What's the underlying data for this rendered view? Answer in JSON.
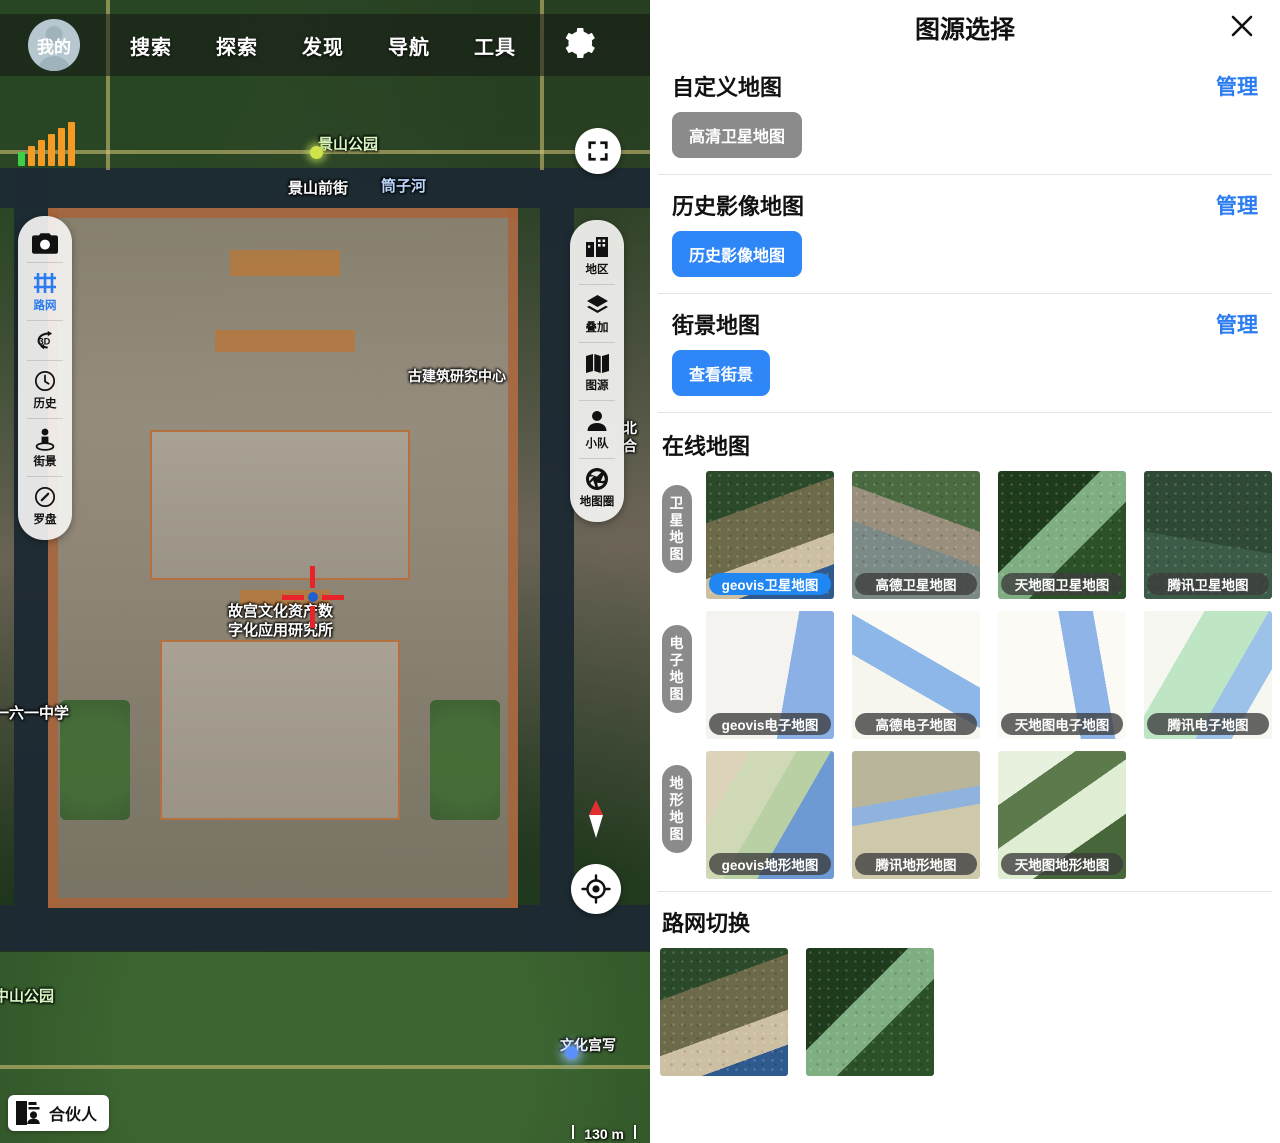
{
  "top_nav": {
    "avatar_label": "我的",
    "items": [
      {
        "label": "搜索",
        "name": "nav-search"
      },
      {
        "label": "探索",
        "name": "nav-explore"
      },
      {
        "label": "发现",
        "name": "nav-discover"
      },
      {
        "label": "导航",
        "name": "nav-navigation"
      },
      {
        "label": "工具",
        "name": "nav-tools"
      }
    ],
    "settings_icon": "gear-icon"
  },
  "map": {
    "scale_label": "130 m",
    "partner_label": "合伙人",
    "labels": [
      {
        "text": "景山公园",
        "color": "green"
      },
      {
        "text": "景山前街",
        "color": "white"
      },
      {
        "text": "筒子河",
        "color": "blue"
      },
      {
        "text": "古建筑研究中心",
        "color": "white"
      },
      {
        "text": "故宫文化资产数\n字化应用研究所",
        "color": "white"
      },
      {
        "text": "一六一中学",
        "color": "white"
      },
      {
        "text": "中山公园",
        "color": "green"
      },
      {
        "text": "文化宫写",
        "color": "white"
      },
      {
        "text": "北\n合",
        "color": "white"
      }
    ],
    "tools_left": [
      {
        "label": "",
        "icon": "camera-icon",
        "name": "map-tool-camera",
        "active": false
      },
      {
        "label": "路网",
        "icon": "road-network-icon",
        "name": "map-tool-road-network",
        "active": true
      },
      {
        "label": "",
        "icon": "3d-rotate-icon",
        "name": "map-tool-3d",
        "active": false
      },
      {
        "label": "历史",
        "icon": "clock-icon",
        "name": "map-tool-history",
        "active": false
      },
      {
        "label": "街景",
        "icon": "street-view-icon",
        "name": "map-tool-streetview",
        "active": false
      },
      {
        "label": "罗盘",
        "icon": "compass-icon",
        "name": "map-tool-compass",
        "active": false
      }
    ],
    "tools_right": [
      {
        "label": "地区",
        "icon": "buildings-icon",
        "name": "map-tool-region"
      },
      {
        "label": "叠加",
        "icon": "layers-icon",
        "name": "map-tool-overlay"
      },
      {
        "label": "图源",
        "icon": "map-book-icon",
        "name": "map-tool-map-source"
      },
      {
        "label": "小队",
        "icon": "team-icon",
        "name": "map-tool-team"
      },
      {
        "label": "地图圈",
        "icon": "aperture-icon",
        "name": "map-tool-map-circle"
      }
    ],
    "fullscreen_icon": "fullscreen-icon",
    "locate_icon": "locate-target-icon",
    "compass_icon": "compass-needle-icon",
    "signal_icon": "signal-bars-icon"
  },
  "panel": {
    "title": "图源选择",
    "close_icon": "close-icon",
    "sections": [
      {
        "title": "自定义地图",
        "manage": "管理",
        "chips": [
          {
            "label": "高清卫星地图",
            "style": "gray"
          }
        ]
      },
      {
        "title": "历史影像地图",
        "manage": "管理",
        "chips": [
          {
            "label": "历史影像地图",
            "style": "blue"
          }
        ]
      },
      {
        "title": "街景地图",
        "manage": "管理",
        "chips": [
          {
            "label": "查看街景",
            "style": "blue"
          }
        ]
      }
    ],
    "online": {
      "title": "在线地图",
      "rows": [
        {
          "tag": "卫星地图",
          "thumbs": [
            {
              "caption": "geovis卫星地图",
              "selected": true,
              "img": "img-sat-1"
            },
            {
              "caption": "高德卫星地图",
              "selected": false,
              "img": "img-sat-2"
            },
            {
              "caption": "天地图卫星地图",
              "selected": false,
              "img": "img-sat-3"
            },
            {
              "caption": "腾讯卫星地图",
              "selected": false,
              "img": "img-sat-4"
            }
          ]
        },
        {
          "tag": "电子地图",
          "thumbs": [
            {
              "caption": "geovis电子地图",
              "selected": false,
              "img": "img-ele-1"
            },
            {
              "caption": "高德电子地图",
              "selected": false,
              "img": "img-ele-2"
            },
            {
              "caption": "天地图电子地图",
              "selected": false,
              "img": "img-ele-3"
            },
            {
              "caption": "腾讯电子地图",
              "selected": false,
              "img": "img-ele-4"
            }
          ]
        },
        {
          "tag": "地形地图",
          "thumbs": [
            {
              "caption": "geovis地形地图",
              "selected": false,
              "img": "img-ter-1"
            },
            {
              "caption": "腾讯地形地图",
              "selected": false,
              "img": "img-ter-2"
            },
            {
              "caption": "天地图地形地图",
              "selected": false,
              "img": "img-ter-3"
            }
          ]
        }
      ]
    },
    "roadnet": {
      "title": "路网切换",
      "thumbs": [
        {
          "caption": "",
          "selected": false,
          "img": "img-rn-1"
        },
        {
          "caption": "",
          "selected": false,
          "img": "img-rn-2"
        }
      ]
    }
  },
  "colors": {
    "accent_blue": "#2b7cf0",
    "chip_blue": "#2f86f6",
    "chip_gray": "#8b8b8b",
    "selected_caption": "#1f86f2"
  }
}
